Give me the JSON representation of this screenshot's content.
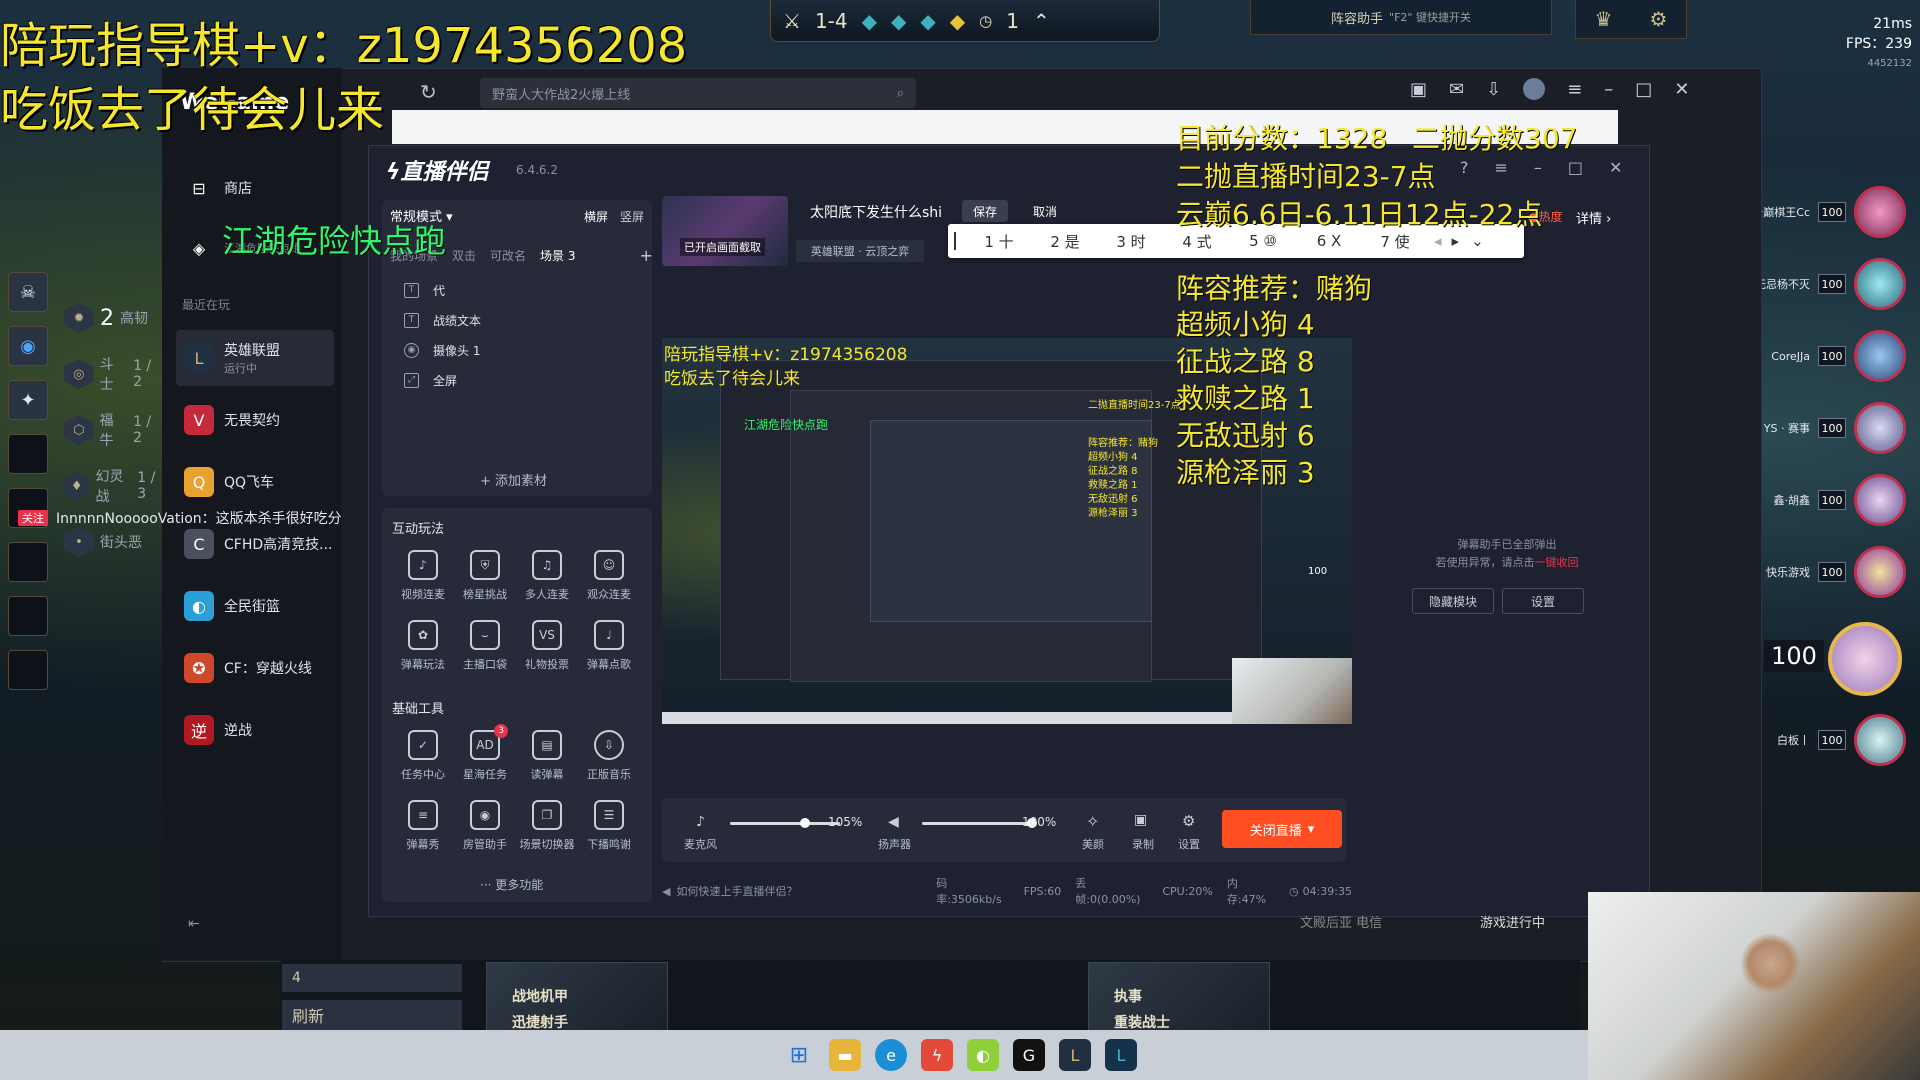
{
  "overlay": {
    "wechat_line": "陪玩指导棋+v：z1974356208",
    "eating_line": "吃饭去了待会儿来",
    "jianghu": "江湖危险快点跑",
    "score_now": "目前分数：1328",
    "score_second": "二抛分数307",
    "second_time": "二抛直播时间23-7点",
    "yunding": "云巅6.6日-6.11日12点-22点",
    "lineup_title": "阵容推荐：赌狗",
    "lineup_1": "超频小狗 4",
    "lineup_2": "征战之路 8",
    "lineup_3": "救赎之路 1",
    "lineup_4": "无敌迅射 6",
    "lineup_5": "源枪泽丽 3"
  },
  "game_hud": {
    "stage": "1-4",
    "timer": "1",
    "helper": "阵容助手",
    "helper_hint": "\"F2\" 键快捷开关",
    "latency": "21ms",
    "fps": "FPS：239",
    "id_num": "4452132",
    "left_ranks": [
      {
        "num": "2",
        "name": "高韧",
        "sub": "2"
      },
      {
        "name": "斗士",
        "sub": "1 / 2"
      },
      {
        "name": "福牛",
        "sub": "1 / 2"
      },
      {
        "name": "幻灵战",
        "sub": "1 / 3"
      },
      {
        "name": "街头恶"
      }
    ],
    "follow_tag": "关注",
    "follow_msg": "InnnnnNoooooVation：这版本杀手很好吃分",
    "me_hp": "100",
    "players": [
      {
        "name": "云巅棋王Cc",
        "hp": "100"
      },
      {
        "name": "无忌杨不灭",
        "hp": "100"
      },
      {
        "name": "CoreJJa",
        "hp": "100"
      },
      {
        "name": "YS · 赛事",
        "hp": "100"
      },
      {
        "name": "鑫·胡鑫",
        "hp": "100"
      },
      {
        "name": "快乐游戏",
        "hp": "100"
      },
      {
        "name": "白板丨",
        "hp": "100"
      }
    ],
    "shop": {
      "gold": "4",
      "refresh": "刷新",
      "trait_a1": "战地机甲",
      "trait_a2": "迅捷射手",
      "trait_b1": "执事",
      "trait_b2": "重装战士",
      "right_label1": "文殿后亚 电信",
      "right_label2": "游戏进行中"
    }
  },
  "wegame": {
    "logo": "WeGame",
    "search_placeholder": "野蛮人大作战2火爆上线",
    "nav": [
      {
        "label": "商店"
      },
      {
        "label": "江湖危险快点跑"
      }
    ],
    "recent_label": "最近在玩",
    "games": [
      {
        "label": "英雄联盟",
        "sub": "运行中"
      },
      {
        "label": "无畏契约"
      },
      {
        "label": "QQ飞车"
      },
      {
        "label": "CFHD高清竞技..."
      },
      {
        "label": "全民街篮"
      },
      {
        "label": "CF：穿越火线"
      },
      {
        "label": "逆战"
      }
    ]
  },
  "stream": {
    "app_title": "直播伴侣",
    "version": "6.4.6.2",
    "scene_mode": "常规模式",
    "orient_h": "横屏",
    "orient_v": "竖屏",
    "scene_tabs": [
      "我的场景",
      "双击",
      "可改名",
      "场景 3"
    ],
    "sources": [
      {
        "label": "代"
      },
      {
        "label": "战绩文本"
      },
      {
        "label": "摄像头 1"
      },
      {
        "label": "全屏"
      }
    ],
    "add_source": "+ 添加素材",
    "interact_label": "互动玩法",
    "interact_tools": [
      "视频连麦",
      "榜星挑战",
      "多人连麦",
      "观众连麦",
      "弹幕玩法",
      "主播口袋",
      "礼物投票",
      "弹幕点歌"
    ],
    "basic_label": "基础工具",
    "basic_tools": [
      "任务中心",
      "星海任务",
      "读弹幕",
      "正版音乐",
      "弹幕秀",
      "房管助手",
      "场景切换器",
      "下播鸣谢"
    ],
    "basic_badge": "3",
    "more_func": "··· 更多功能",
    "thumb_label": "已开启画面截取",
    "stream_title": "太阳底下发生什么shi",
    "save": "保存",
    "cancel": "取消",
    "category": "英雄联盟 · 云顶之弈",
    "ime_input": "十",
    "ime_candidates": [
      "1 十",
      "2 是",
      "3 时",
      "4 式",
      "5 ⑩",
      "6 X",
      "7 使"
    ],
    "hot": "热度",
    "detail": "详情",
    "danmu_msg_1": "弹幕助手已全部弹出",
    "danmu_msg_2": "若使用异常，请点击",
    "danmu_link": "一键收回",
    "hide_module": "隐藏模块",
    "settings": "设置",
    "mic_label": "麦克风",
    "mic_pct": "105%",
    "speaker_label": "扬声器",
    "speaker_pct": "100%",
    "beauty": "美颜",
    "record": "录制",
    "ctrl_settings": "设置",
    "close_live": "关闭直播",
    "help": "如何快速上手直播伴侣？",
    "bitrate": "码率:3506kb/s",
    "fps": "FPS:60",
    "drop": "丢帧:0(0.00%)",
    "cpu": "CPU:20%",
    "mem": "内存:47%",
    "duration": "04:39:35",
    "mic_level": 0.68,
    "speaker_level": 1.0
  },
  "preview": {
    "wx": "陪玩指导棋+v：z1974356208",
    "eat": "吃饭去了待会儿来",
    "jianghu": "江湖危险快点跑",
    "l1": "二抛直播时间23-7点",
    "l2": "阵容推荐：赌狗",
    "l3": "超频小狗 4",
    "l4": "征战之路 8",
    "l5": "救赎之路 1",
    "l6": "无敌迅射 6",
    "l7": "源枪泽丽 3",
    "hp": "100"
  }
}
